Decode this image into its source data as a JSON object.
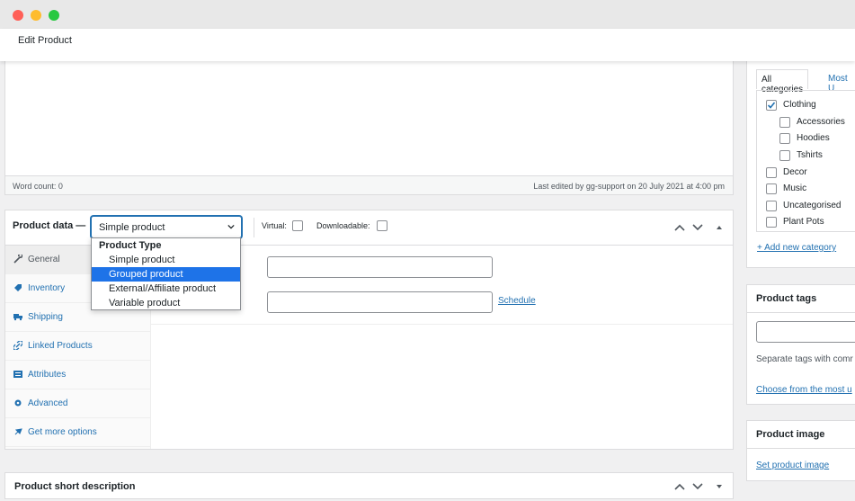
{
  "window": {
    "title": "Edit Product"
  },
  "editor": {
    "word_count": "Word count: 0",
    "last_edited": "Last edited by gg-support on 20 July 2021 at 4:00 pm"
  },
  "product_data": {
    "label": "Product data —",
    "selected_type": "Simple product",
    "virtual_label": "Virtual:",
    "downloadable_label": "Downloadable:",
    "dropdown": {
      "group_label": "Product Type",
      "options": [
        "Simple product",
        "Grouped product",
        "External/Affiliate product",
        "Variable product"
      ],
      "highlighted": "Grouped product"
    },
    "tabs": [
      {
        "label": "General",
        "icon": "wrench-icon"
      },
      {
        "label": "Inventory",
        "icon": "tag-icon"
      },
      {
        "label": "Shipping",
        "icon": "truck-icon"
      },
      {
        "label": "Linked Products",
        "icon": "link-icon"
      },
      {
        "label": "Attributes",
        "icon": "list-icon"
      },
      {
        "label": "Advanced",
        "icon": "gear-icon"
      },
      {
        "label": "Get more options",
        "icon": "plugin-icon"
      }
    ],
    "schedule_link": "Schedule"
  },
  "short_description": {
    "label": "Product short description"
  },
  "categories": {
    "tab_all": "All categories",
    "tab_most": "Most U",
    "items": [
      {
        "label": "Clothing",
        "checked": true,
        "indent": false
      },
      {
        "label": "Accessories",
        "checked": false,
        "indent": true
      },
      {
        "label": "Hoodies",
        "checked": false,
        "indent": true
      },
      {
        "label": "Tshirts",
        "checked": false,
        "indent": true
      },
      {
        "label": "Decor",
        "checked": false,
        "indent": false
      },
      {
        "label": "Music",
        "checked": false,
        "indent": false
      },
      {
        "label": "Uncategorised",
        "checked": false,
        "indent": false
      },
      {
        "label": "Plant Pots",
        "checked": false,
        "indent": false
      }
    ],
    "add_link": "+ Add new category"
  },
  "tags": {
    "title": "Product tags",
    "help": "Separate tags with comr",
    "link": "Choose from the most u"
  },
  "product_image": {
    "title": "Product image",
    "link": "Set product image"
  },
  "colors": {
    "accent": "#2271b1",
    "highlight": "#1e73e8"
  }
}
